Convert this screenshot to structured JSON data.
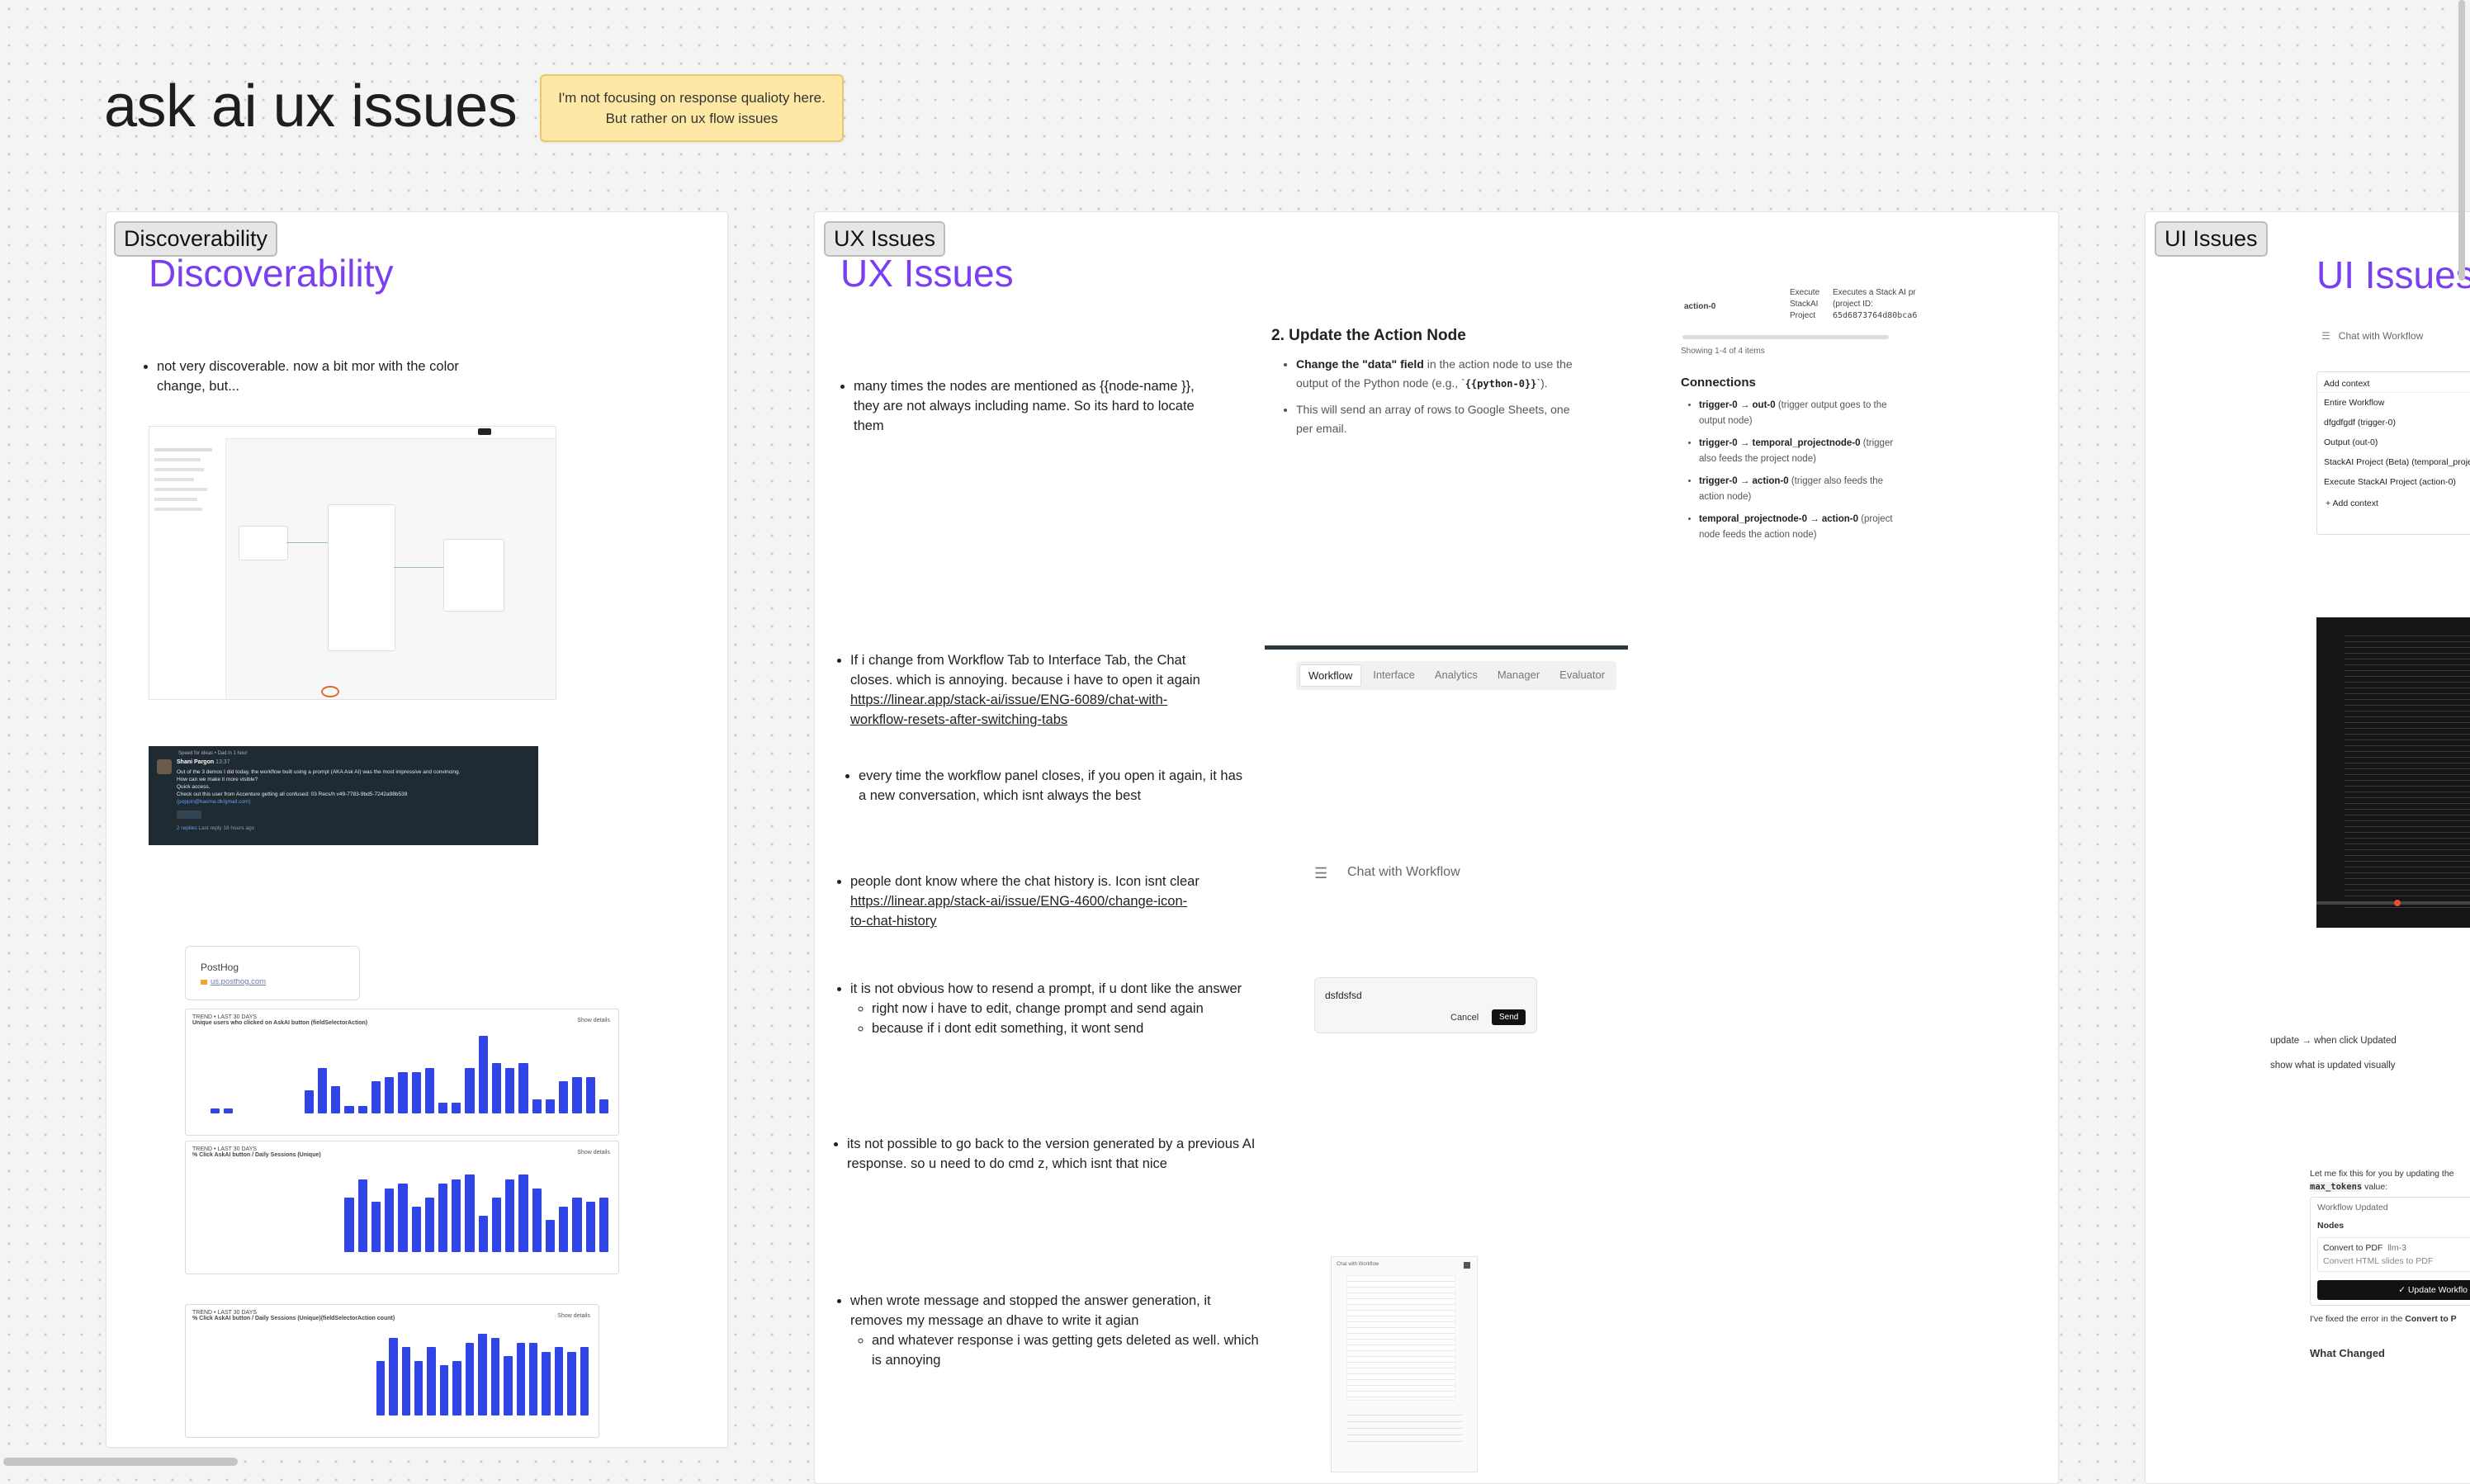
{
  "board": {
    "title": "ask ai ux issues",
    "sticky": [
      "I'm not focusing on response qualioty here.",
      "But rather on ux flow issues"
    ]
  },
  "sections": {
    "discoverability": {
      "tag": "Discoverability",
      "heading": "Discoverability",
      "note": [
        "not very discoverable. now a bit mor with the color",
        "change, but..."
      ],
      "slack": {
        "channel": "Speed for ideas • Dad in 1 hour",
        "author": "Shani Pargon",
        "time": "13:37",
        "lines": [
          "Out of the 3 demos I did today, the workflow built using a prompt (AKA Ask AI) was the most impressive and convincing.",
          "How can we make it more visible?",
          "Quick access.",
          "Check out this user from Accenture getting all confused: 03 Recs/h v49-7783-9bd5-7242a98b539",
          "(poppin@kasma.dk/gmail.com)"
        ],
        "replies": "2 replies",
        "last_reply": "Last reply 18 hours ago"
      },
      "posthog": {
        "title": "PostHog",
        "url": "us.posthog.com"
      },
      "charts": [
        {
          "title": "TREND • LAST 30 DAYS",
          "subtitle": "Unique users who clicked on AskAI button (fieldSelectorAction)",
          "badge": "Show details"
        },
        {
          "title": "TREND • LAST 30 DAYS",
          "subtitle": "% Click AskAI button / Daily Sessions (Unique)",
          "badge": "Show details"
        },
        {
          "title": "TREND • LAST 30 DAYS",
          "subtitle": "% Click AskAI button / Daily Sessions (Unique)(fieldSelectorAction count)",
          "badge": "Show details"
        }
      ]
    },
    "ux": {
      "tag": "UX Issues",
      "heading": "UX Issues",
      "notes": {
        "node_names": [
          "many times the nodes are mentioned as {{node-name }},",
          "they are not always including name. So its hard to locate",
          "them"
        ],
        "tab_switch": [
          "If i change from Workflow Tab to Interface Tab, the Chat",
          "closes. which is annoying. because i have to open it again"
        ],
        "tab_switch_link": [
          "https://linear.app/stack-ai/issue/ENG-6089/chat-with-",
          "workflow-resets-after-switching-tabs"
        ],
        "new_conversation": [
          "every time the workflow panel closes, if you open it again, it has",
          "a new conversation, which isnt always the best"
        ],
        "chat_history": [
          "people dont know where the chat history is. Icon isnt clear"
        ],
        "chat_history_link": [
          "https://linear.app/stack-ai/issue/ENG-4600/change-icon-",
          "to-chat-history"
        ],
        "resend": "it is not obvious how to resend a prompt, if u dont like the answer",
        "resend_sub": [
          "right now i have to edit, change prompt and send again",
          "because if i dont edit something, it wont send"
        ],
        "version": [
          "its not possible to go back to the version generated by a previous AI",
          "response.  so u need to do cmd z, which isnt that nice"
        ],
        "stop": [
          "when wrote message and stopped the answer generation, it",
          "removes my message an dhave to write it agian"
        ],
        "stop_sub": [
          "and whatever response i was getting gets deleted as well. which",
          "is annoying"
        ]
      },
      "update_action": {
        "heading": "2. Update the Action Node",
        "bullet1_bold": "Change the \"data\" field",
        "bullet1_rest": [
          " in the action node to use the",
          "output of the Python node (e.g., `",
          "{{python-0}}",
          "`)."
        ],
        "bullet2": [
          "This will send an array of rows to Google Sheets, one",
          "per email."
        ]
      },
      "table_snip": {
        "cell1": "action-0",
        "cell2": [
          "Execute",
          "StackAI",
          "Project"
        ],
        "cell3": [
          "Executes a Stack AI pr",
          "(project ID:",
          "65d6873764d80bca6"
        ],
        "showing": "Showing 1-4 of 4 items"
      },
      "connections": {
        "heading": "Connections",
        "items": [
          {
            "bold": "trigger-0 → out-0",
            "rest": [
              "(trigger output goes to the",
              "output node)"
            ]
          },
          {
            "bold": "trigger-0 → temporal_projectnode-0",
            "rest": [
              "(trigger",
              "also feeds the project node)"
            ]
          },
          {
            "bold": "trigger-0 → action-0",
            "rest": [
              "(trigger also feeds the",
              "action node)"
            ]
          },
          {
            "bold": "temporal_projectnode-0 → action-0",
            "rest": [
              "(project",
              "node feeds the action node)"
            ]
          }
        ]
      },
      "tabs": [
        "Workflow",
        "Interface",
        "Analytics",
        "Manager",
        "Evaluator"
      ],
      "chat_header": "Chat with Workflow",
      "edit_box": {
        "value": "dsfdsfsd",
        "cancel": "Cancel",
        "send": "Send"
      }
    },
    "ui": {
      "tag": "UI Issues",
      "heading": "UI Issues",
      "chat_title": "Chat with Workflow",
      "context_menu": {
        "title": "Add context",
        "items": [
          "Entire Workflow",
          "dfgdfgdf (trigger-0)",
          "Output (out-0)",
          "StackAI Project (Beta) (temporal_projec",
          "Execute StackAI Project (action-0)"
        ],
        "add": "+ Add context"
      },
      "update_notes": [
        "update → when click Updated",
        "show what is updated visually"
      ],
      "fix_card": {
        "intro": "Let me fix this for you by updating the",
        "code": "max_tokens",
        "intro_rest": " value:",
        "status": "Workflow Updated",
        "nodes_label": "Nodes",
        "node_name": "Convert to PDF",
        "node_id": "llm-3",
        "node_desc": "Convert HTML slides to PDF",
        "button": "✓ Update Workflo",
        "after": "I've fixed the error in the",
        "after_bold": "Convert to P",
        "what_changed": "What Changed"
      }
    }
  },
  "colors": {
    "accent_purple": "#7b3ff2",
    "chart_blue": "#2f45e8",
    "sticky": "#fde9a5"
  },
  "icons": [
    "hamburger-icon",
    "avatar-icon",
    "posthog-logo-icon",
    "close-icon"
  ]
}
